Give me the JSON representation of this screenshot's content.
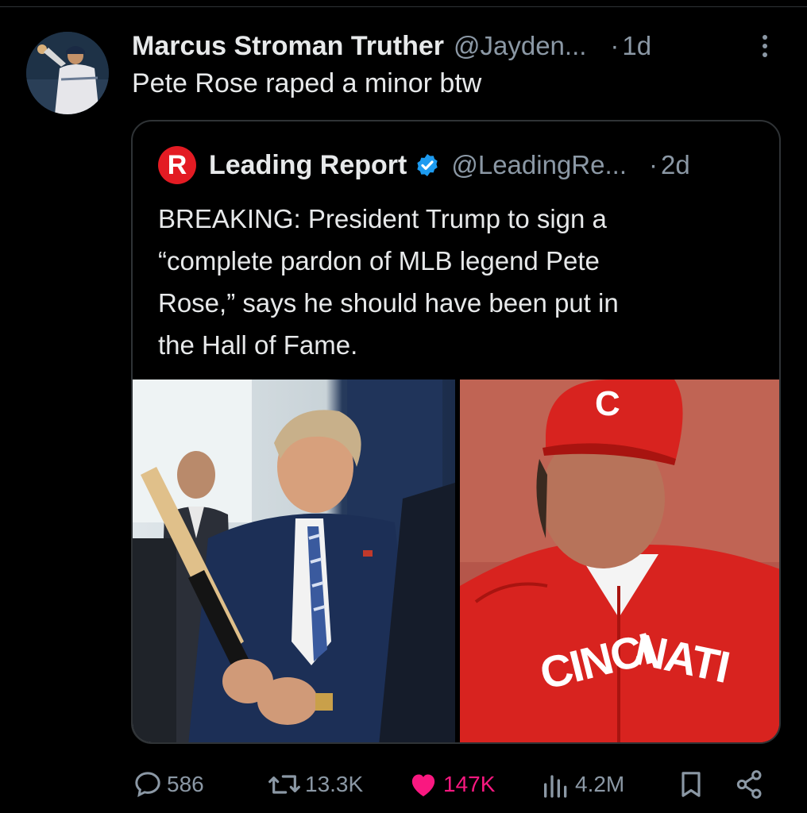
{
  "tweet": {
    "display_name": "Marcus Stroman Truther",
    "handle": "@Jayden...",
    "time": "1d",
    "separator": "·",
    "text": "Pete Rose raped a minor btw",
    "avatar_icon": "profile-photo-baseball-player"
  },
  "quoted": {
    "logo_letter": "R",
    "display_name": "Leading Report",
    "verified": true,
    "handle": "@LeadingRe...",
    "time": "2d",
    "separator": "·",
    "text_lines": [
      "BREAKING: President Trump to sign a",
      "“complete pardon of MLB legend Pete",
      "Rose,” says he should have been put in",
      "the Hall of Fame."
    ],
    "images": [
      {
        "icon": "photo-man-swinging-baseball-bat"
      },
      {
        "icon": "photo-man-in-red-cincinnati-jacket",
        "jacket_text_left": "CINCI",
        "jacket_text_right": "NATI",
        "cap_letter": "C"
      }
    ]
  },
  "actions": {
    "replies": "586",
    "reposts": "13.3K",
    "likes": "147K",
    "views": "4.2M",
    "reply_icon": "speech-bubble-icon",
    "repost_icon": "repost-arrows-icon",
    "like_icon": "heart-icon",
    "views_icon": "bar-chart-icon",
    "bookmark_icon": "bookmark-icon",
    "share_icon": "share-icon"
  },
  "colors": {
    "background": "#000000",
    "text": "#e7e9ea",
    "secondary": "#8b98a5",
    "like": "#f91880",
    "verified": "#1d9bf0",
    "brand_red": "#e31b23"
  }
}
